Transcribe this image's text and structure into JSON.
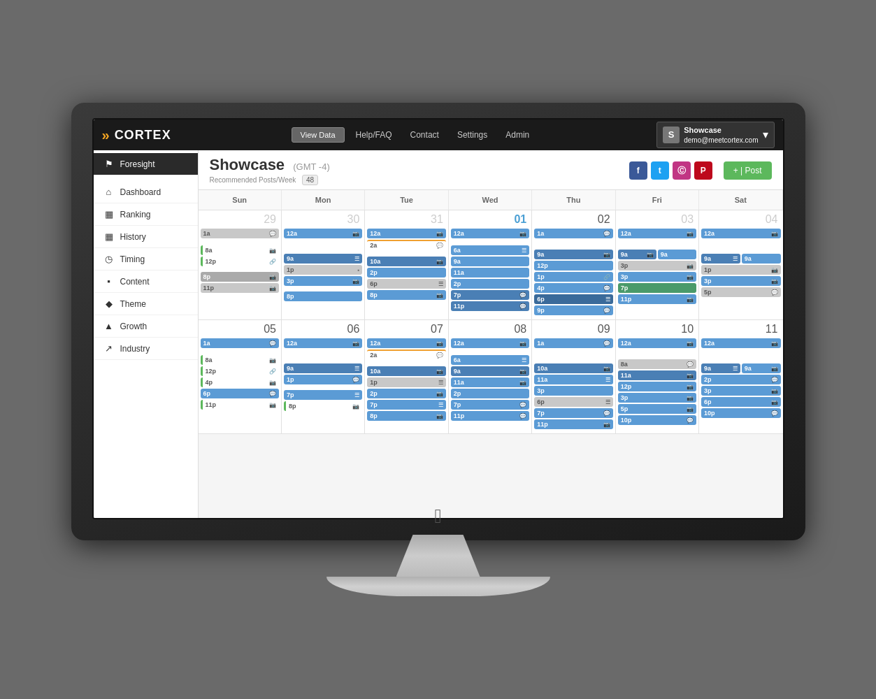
{
  "monitor": {
    "apple_symbol": "&#63743;"
  },
  "topnav": {
    "logo": "CORTEX",
    "view_data": "View Data",
    "help_faq": "Help/FAQ",
    "contact": "Contact",
    "settings": "Settings",
    "admin": "Admin",
    "user_name": "Showcase",
    "user_email": "demo@meetcortex.com",
    "user_initial": "S"
  },
  "sidebar": {
    "foresight": "Foresight",
    "items": [
      {
        "label": "Dashboard",
        "icon": "⌂"
      },
      {
        "label": "Ranking",
        "icon": "▦"
      },
      {
        "label": "History",
        "icon": "▦"
      },
      {
        "label": "Timing",
        "icon": "◷"
      },
      {
        "label": "Content",
        "icon": "▪"
      },
      {
        "label": "Theme",
        "icon": "◆"
      },
      {
        "label": "Growth",
        "icon": "▲"
      },
      {
        "label": "Industry",
        "icon": "↗"
      }
    ]
  },
  "page": {
    "title": "Showcase",
    "timezone": "(GMT -4)",
    "rec_label": "Recommended Posts/Week",
    "rec_value": "48",
    "add_post": "+ | Post"
  },
  "calendar": {
    "days": [
      "Sun",
      "Mon",
      "Tue",
      "Wed",
      "Thu",
      "Fri",
      "Sat"
    ],
    "week1": {
      "dates": [
        "29",
        "30",
        "31",
        "01",
        "02",
        "03",
        "04"
      ],
      "current_date": "01"
    },
    "week2": {
      "dates": [
        "05",
        "06",
        "07",
        "08",
        "09",
        "10",
        "11"
      ]
    }
  }
}
